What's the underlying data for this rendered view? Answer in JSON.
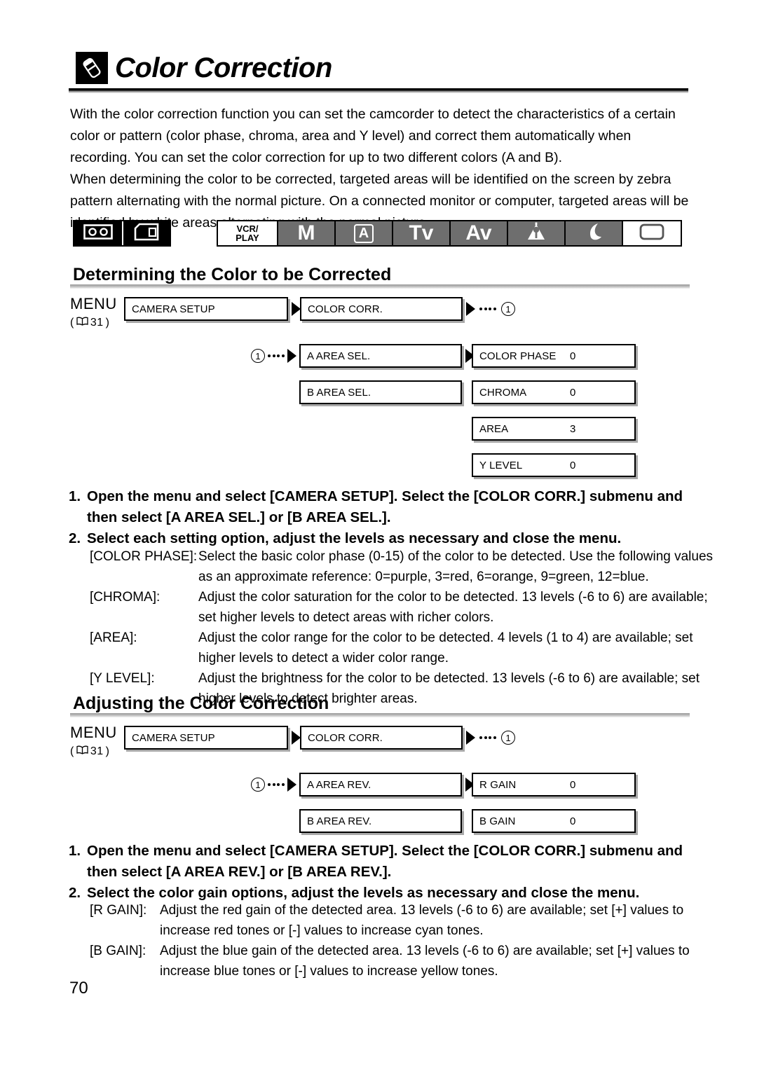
{
  "header": {
    "badge_icon": "color-correction-badge-icon",
    "title": "Color Correction",
    "page_number": "70"
  },
  "intro": {
    "paragraph_1": "With the color correction function you can set the camcorder to detect the characteristics of a certain color or pattern (color phase, chroma, area and Y level) and correct them automatically when recording. You can set the color correction for up to two different colors (A and B).",
    "paragraph_2": "When determining the color to be corrected, targeted areas will be identified on the screen by zebra pattern alternating with the normal picture. On a connected monitor or computer, targeted areas will be identified by white areas alternating with the normal picture."
  },
  "mode_bar": {
    "media": [
      {
        "icon": "tape-cassette-icon",
        "name": "media-tape"
      },
      {
        "icon": "memory-card-icon",
        "name": "media-card"
      }
    ],
    "modes": [
      {
        "label": "VCR/\nPLAY",
        "line1": "VCR/",
        "line2": "PLAY",
        "name": "mode-vcr-play",
        "active": false
      },
      {
        "label": "M",
        "name": "mode-manual",
        "active": true
      },
      {
        "label": "A",
        "name": "mode-auto",
        "active": true
      },
      {
        "label": "Tv",
        "name": "mode-tv",
        "active": true
      },
      {
        "label": "Av",
        "name": "mode-av",
        "active": true
      },
      {
        "label": "spotlight-icon",
        "name": "mode-spotlight",
        "active": true
      },
      {
        "label": "moon-icon",
        "name": "mode-night",
        "active": true
      },
      {
        "label": "rounded-rect-icon",
        "name": "mode-card-rec",
        "active": false
      }
    ]
  },
  "section_1": {
    "heading": "Determining the Color to be Corrected",
    "menu": {
      "label": "MENU",
      "ref_open": "(",
      "ref_page": "31",
      "ref_close": ")",
      "row1": [
        {
          "text": "CAMERA SETUP",
          "value": ""
        },
        {
          "text": "COLOR CORR.",
          "value": ""
        }
      ],
      "marker": "1",
      "row2_col1": [
        {
          "text": "A AREA SEL.",
          "value": ""
        },
        {
          "text": "B AREA SEL.",
          "value": ""
        }
      ],
      "row2_col2": [
        {
          "text": "COLOR PHASE",
          "value": "0"
        },
        {
          "text": "CHROMA",
          "value": "0"
        },
        {
          "text": "AREA",
          "value": "3"
        },
        {
          "text": "Y LEVEL",
          "value": "0"
        }
      ]
    },
    "steps": [
      {
        "num": "1.",
        "text": "Open the menu and select [CAMERA SETUP]. Select the [COLOR CORR.] submenu and then select [A AREA SEL.] or [B AREA SEL.]."
      },
      {
        "num": "2.",
        "text": "Select each setting option, adjust the levels as necessary and close the menu."
      }
    ],
    "params": [
      {
        "term": "[COLOR PHASE]:",
        "desc": "Select the basic color phase (0-15) of the color to be detected. Use the following values as an approximate reference: 0=purple, 3=red, 6=orange, 9=green, 12=blue."
      },
      {
        "term": "[CHROMA]:",
        "desc": "Adjust the color saturation for the color to be detected. 13 levels (-6 to 6) are available; set higher levels to detect areas with richer colors."
      },
      {
        "term": "[AREA]:",
        "desc": "Adjust the color range for the color to be detected. 4 levels (1 to 4) are available; set higher levels to detect a wider color range."
      },
      {
        "term": "[Y LEVEL]:",
        "desc": "Adjust the brightness for the color to be detected. 13 levels (-6 to 6) are available; set higher levels to detect brighter areas."
      }
    ]
  },
  "section_2": {
    "heading": "Adjusting the Color Correction",
    "menu": {
      "label": "MENU",
      "ref_open": "(",
      "ref_page": "31",
      "ref_close": ")",
      "row1": [
        {
          "text": "CAMERA SETUP",
          "value": ""
        },
        {
          "text": "COLOR CORR.",
          "value": ""
        }
      ],
      "marker": "1",
      "row2_col1": [
        {
          "text": "A AREA REV.",
          "value": ""
        },
        {
          "text": "B AREA REV.",
          "value": ""
        }
      ],
      "row2_col2": [
        {
          "text": "R GAIN",
          "value": "0"
        },
        {
          "text": "B GAIN",
          "value": "0"
        }
      ]
    },
    "steps": [
      {
        "num": "1.",
        "text": "Open the menu and select [CAMERA SETUP]. Select the [COLOR CORR.] submenu and then select [A AREA REV.] or [B AREA REV.]."
      },
      {
        "num": "2.",
        "text": "Select the color gain options, adjust the levels as necessary and close the menu."
      }
    ],
    "params": [
      {
        "term": "[R GAIN]:",
        "desc": "Adjust the red gain of the detected area. 13 levels (-6 to 6) are available; set [+] values to increase red tones or [-] values to increase cyan tones."
      },
      {
        "term": "[B GAIN]:",
        "desc": "Adjust the blue gain of the detected area. 13 levels (-6 to 6) are available; set [+] values to increase blue tones or [-] values to increase yellow tones."
      }
    ]
  },
  "colors": {
    "text": "#000000",
    "mode_active_bg": "#6e6e6e",
    "mode_inactive_bg": "#ffffff",
    "box_shadow": "#a8a8a8",
    "rule_gradient_start": "#9a9a9a"
  }
}
